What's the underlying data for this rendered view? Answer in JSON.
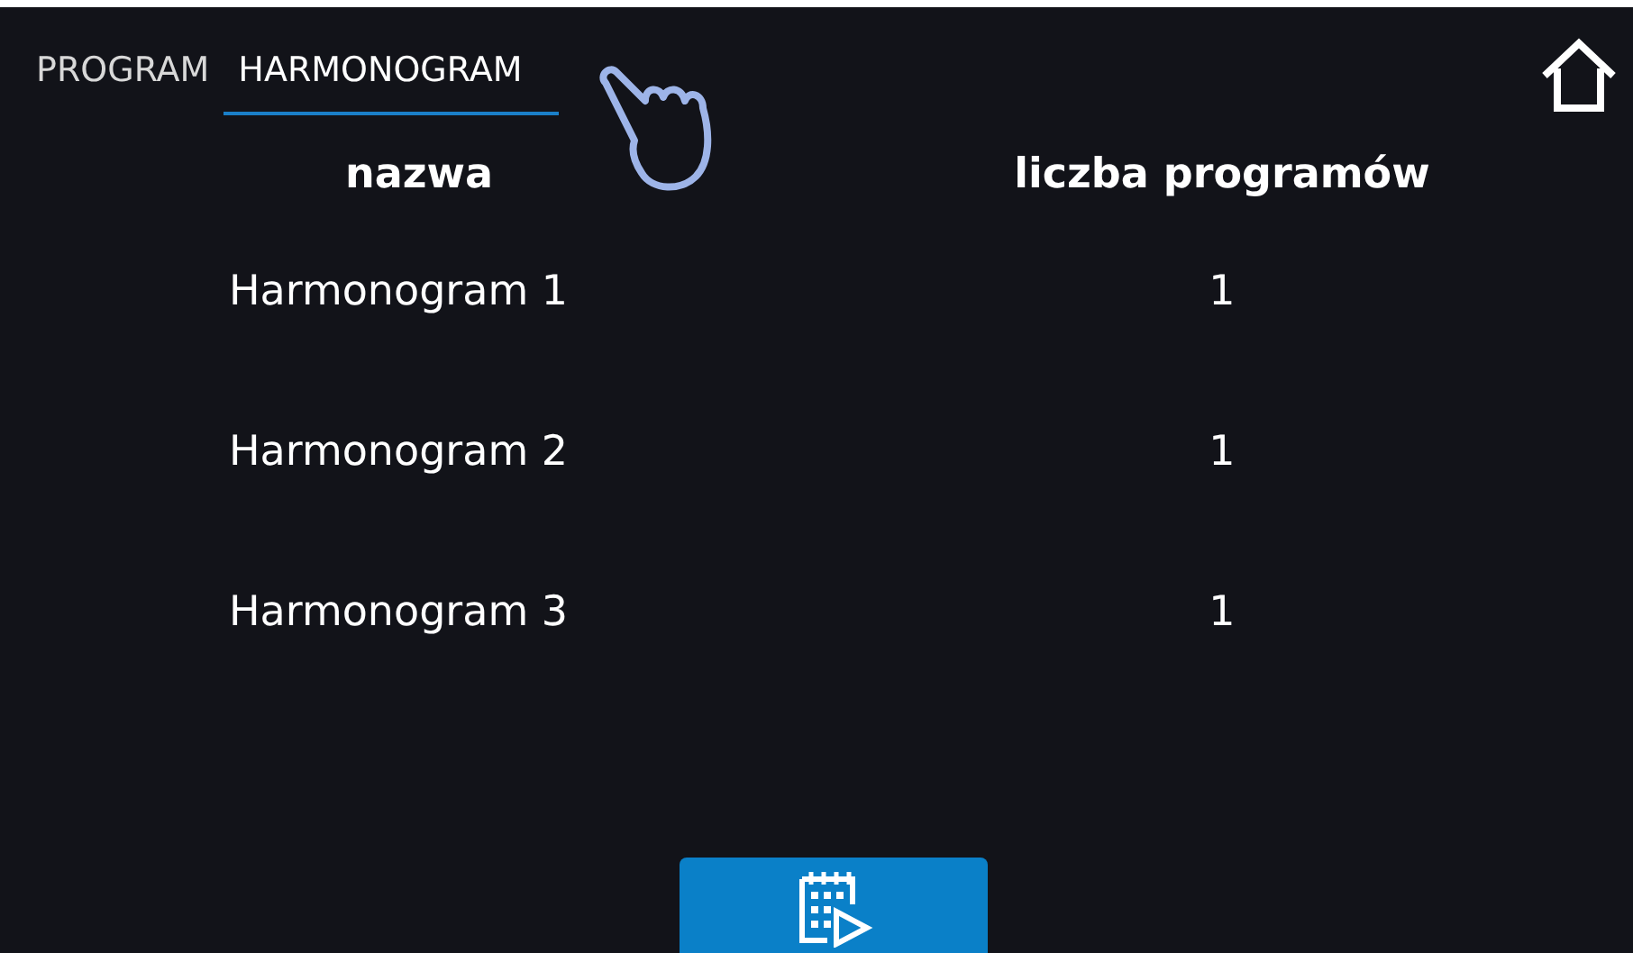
{
  "tabs": [
    {
      "label": "PROGRAM",
      "selected": false
    },
    {
      "label": "HARMONOGRAM",
      "selected": true
    }
  ],
  "table": {
    "columns": [
      "nazwa",
      "liczba programów"
    ],
    "rows": [
      {
        "name": "Harmonogram 1",
        "count": "1"
      },
      {
        "name": "Harmonogram 2",
        "count": "1"
      },
      {
        "name": "Harmonogram 3",
        "count": "1"
      }
    ]
  }
}
